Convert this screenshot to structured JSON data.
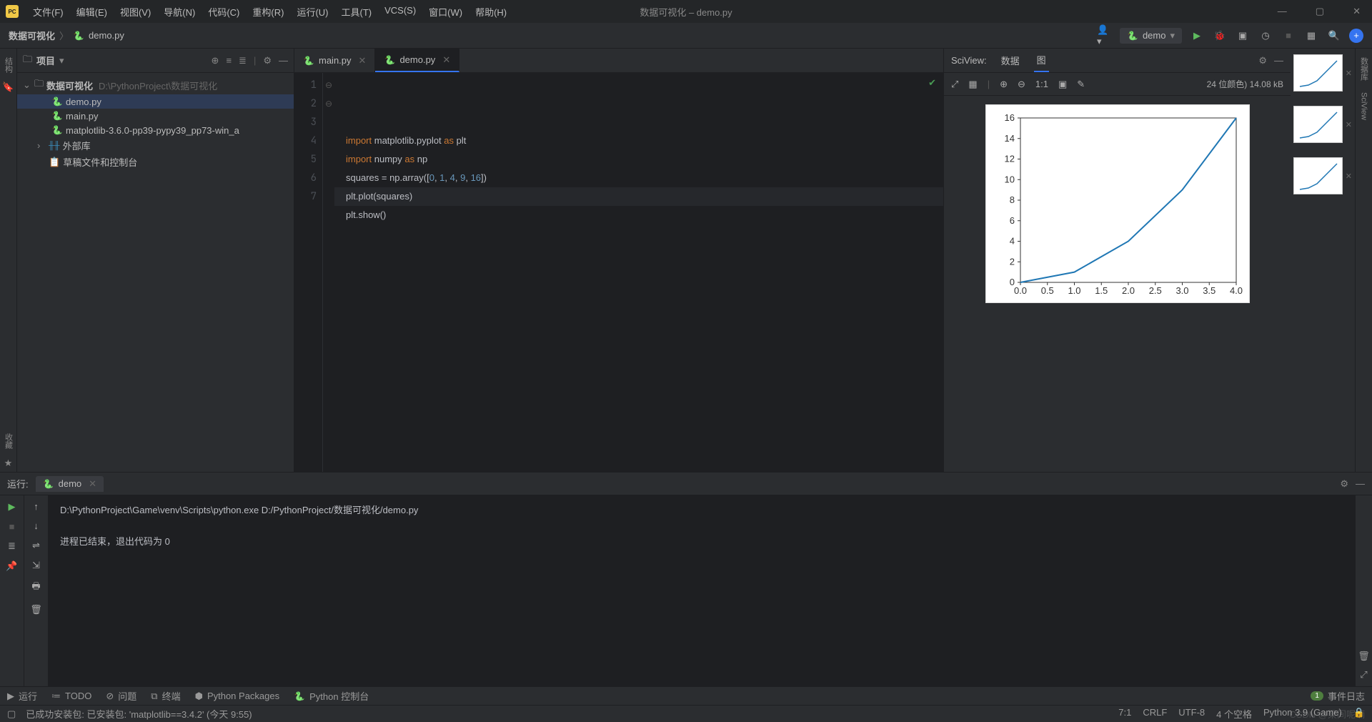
{
  "window_title": "数据可视化 – demo.py",
  "menu": [
    "文件(F)",
    "编辑(E)",
    "视图(V)",
    "导航(N)",
    "代码(C)",
    "重构(R)",
    "运行(U)",
    "工具(T)",
    "VCS(S)",
    "窗口(W)",
    "帮助(H)"
  ],
  "breadcrumb": {
    "root": "数据可视化",
    "file": "demo.py"
  },
  "run_config": "demo",
  "project": {
    "panel_label": "项目",
    "root": "数据可视化",
    "root_path": "D:\\PythonProject\\数据可视化",
    "files": [
      "demo.py",
      "main.py",
      "matplotlib-3.6.0-pp39-pypy39_pp73-win_a"
    ],
    "ext_lib": "外部库",
    "scratches": "草稿文件和控制台"
  },
  "editor": {
    "tabs": [
      {
        "name": "main.py",
        "active": false
      },
      {
        "name": "demo.py",
        "active": true
      }
    ],
    "lines": [
      "1",
      "2",
      "3",
      "4",
      "5",
      "6",
      "7"
    ],
    "code_tokens": [
      [
        {
          "t": "import ",
          "c": "kw"
        },
        {
          "t": "matplotlib.pyplot ",
          "c": ""
        },
        {
          "t": "as ",
          "c": "kw"
        },
        {
          "t": "plt",
          "c": ""
        }
      ],
      [
        {
          "t": "import ",
          "c": "kw"
        },
        {
          "t": "numpy ",
          "c": ""
        },
        {
          "t": "as ",
          "c": "kw"
        },
        {
          "t": "np",
          "c": ""
        }
      ],
      [
        {
          "t": "",
          "c": ""
        }
      ],
      [
        {
          "t": "squares = np.array([",
          "c": ""
        },
        {
          "t": "0",
          "c": "num"
        },
        {
          "t": ", ",
          "c": ""
        },
        {
          "t": "1",
          "c": "num"
        },
        {
          "t": ", ",
          "c": ""
        },
        {
          "t": "4",
          "c": "num"
        },
        {
          "t": ", ",
          "c": ""
        },
        {
          "t": "9",
          "c": "num"
        },
        {
          "t": ", ",
          "c": ""
        },
        {
          "t": "16",
          "c": "num"
        },
        {
          "t": "])",
          "c": ""
        }
      ],
      [
        {
          "t": "plt.plot(squares)",
          "c": ""
        }
      ],
      [
        {
          "t": "plt.show()",
          "c": ""
        }
      ],
      [
        {
          "t": "",
          "c": ""
        }
      ]
    ]
  },
  "sciview": {
    "label": "SciView:",
    "tabs": {
      "data": "数据",
      "plot": "图"
    },
    "info": "24 位颜色) 14.08 kB",
    "ratio": "1:1"
  },
  "chart_data": {
    "type": "line",
    "x": [
      0,
      1,
      2,
      3,
      4
    ],
    "values": [
      0,
      1,
      4,
      9,
      16
    ],
    "xlabel": "",
    "ylabel": "",
    "xticks": [
      "0.0",
      "0.5",
      "1.0",
      "1.5",
      "2.0",
      "2.5",
      "3.0",
      "3.5",
      "4.0"
    ],
    "yticks": [
      "0",
      "2",
      "4",
      "6",
      "8",
      "10",
      "12",
      "14",
      "16"
    ],
    "xlim": [
      0,
      4
    ],
    "ylim": [
      0,
      16
    ]
  },
  "run": {
    "label": "运行:",
    "tab": "demo",
    "output_line1": "D:\\PythonProject\\Game\\venv\\Scripts\\python.exe D:/PythonProject/数据可视化/demo.py",
    "output_line2": "进程已结束，退出代码为 0"
  },
  "bottom_tools": {
    "run": "运行",
    "todo": "TODO",
    "problems": "问题",
    "terminal": "终端",
    "packages": "Python Packages",
    "console": "Python 控制台",
    "events": "事件日志",
    "events_count": "1"
  },
  "status": {
    "msg": "已成功安装包: 已安装包: 'matplotlib==3.4.2' (今天 9:55)",
    "pos": "7:1",
    "encoding_sep": "CRLF",
    "encoding": "UTF-8",
    "indent": "4 个空格",
    "python": "Python 3.9 (Game)",
    "watermark": "CSDN @梁间呢喃"
  },
  "gutters": {
    "structure": "结构",
    "fav": "收藏",
    "db": "数据库",
    "sci": "SciView"
  }
}
